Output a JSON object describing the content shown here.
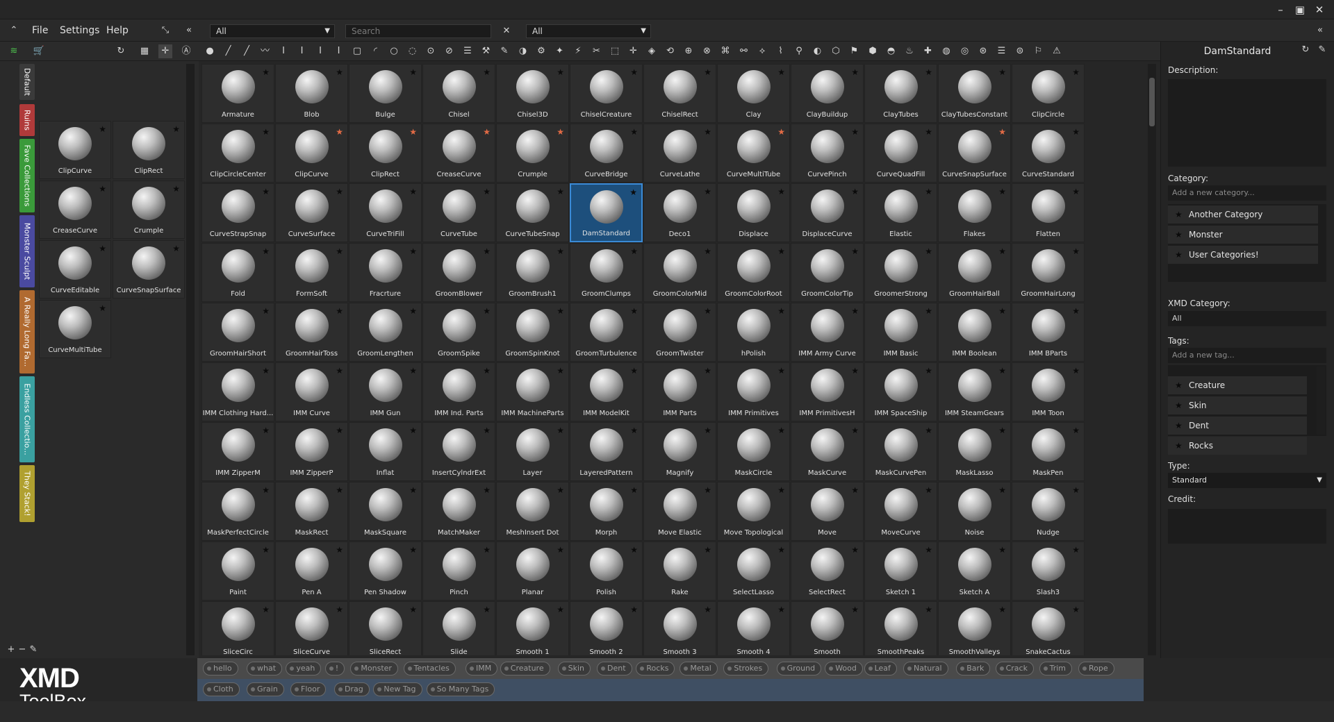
{
  "window": {
    "minimize": "–",
    "maximize": "▣",
    "close": "✕"
  },
  "menu": {
    "items": [
      "File",
      "Settings",
      "Help"
    ]
  },
  "filters": {
    "left_select": "All",
    "search_placeholder": "Search",
    "search_clear": "✕",
    "right_select": "All"
  },
  "left_tabs": [
    {
      "label": "Default",
      "color": "#3a3a3a"
    },
    {
      "label": "Ruins",
      "color": "#b03a3a"
    },
    {
      "label": "Fave Collections",
      "color": "#3a9a3a"
    },
    {
      "label": "Monster Sculpt",
      "color": "#4a4aa0"
    },
    {
      "label": "A Really Long Fa...",
      "color": "#b06a30"
    },
    {
      "label": "Endless Collectio...",
      "color": "#3aa0a0"
    },
    {
      "label": "They Stack!",
      "color": "#b0a030"
    }
  ],
  "left_brushes": [
    "ClipCurve",
    "ClipRect",
    "CreaseCurve",
    "Crumple",
    "CurveEditable",
    "CurveSnapSurface",
    "CurveMultiTube"
  ],
  "brushes": [
    "Armature",
    "Blob",
    "Bulge",
    "Chisel",
    "Chisel3D",
    "ChiselCreature",
    "ChiselRect",
    "Clay",
    "ClayBuildup",
    "ClayTubes",
    "ClayTubesConstant",
    "ClipCircle",
    "ClipCircleCenter",
    "ClipCurve",
    "ClipRect",
    "CreaseCurve",
    "Crumple",
    "CurveBridge",
    "CurveLathe",
    "CurveMultiTube",
    "CurvePinch",
    "CurveQuadFill",
    "CurveSnapSurface",
    "CurveStandard",
    "CurveStrapSnap",
    "CurveSurface",
    "CurveTriFill",
    "CurveTube",
    "CurveTubeSnap",
    "DamStandard",
    "Deco1",
    "Displace",
    "DisplaceCurve",
    "Elastic",
    "Flakes",
    "Flatten",
    "Fold",
    "FormSoft",
    "Fracrture",
    "GroomBlower",
    "GroomBrush1",
    "GroomClumps",
    "GroomColorMid",
    "GroomColorRoot",
    "GroomColorTip",
    "GroomerStrong",
    "GroomHairBall",
    "GroomHairLong",
    "GroomHairShort",
    "GroomHairToss",
    "GroomLengthen",
    "GroomSpike",
    "GroomSpinKnot",
    "GroomTurbulence",
    "GroomTwister",
    "hPolish",
    "IMM Army Curve",
    "IMM Basic",
    "IMM Boolean",
    "IMM BParts",
    "IMM Clothing Hard...",
    "IMM Curve",
    "IMM Gun",
    "IMM Ind. Parts",
    "IMM MachineParts",
    "IMM ModelKit",
    "IMM Parts",
    "IMM Primitives",
    "IMM PrimitivesH",
    "IMM SpaceShip",
    "IMM SteamGears",
    "IMM Toon",
    "IMM ZipperM",
    "IMM ZipperP",
    "Inflat",
    "InsertCylndrExt",
    "Layer",
    "LayeredPattern",
    "Magnify",
    "MaskCircle",
    "MaskCurve",
    "MaskCurvePen",
    "MaskLasso",
    "MaskPen",
    "MaskPerfectCircle",
    "MaskRect",
    "MaskSquare",
    "MatchMaker",
    "MeshInsert Dot",
    "Morph",
    "Move Elastic",
    "Move Topological",
    "Move",
    "MoveCurve",
    "Noise",
    "Nudge",
    "Paint",
    "Pen A",
    "Pen Shadow",
    "Pinch",
    "Planar",
    "Polish",
    "Rake",
    "SelectLasso",
    "SelectRect",
    "Sketch 1",
    "Sketch A",
    "Slash3",
    "SliceCirc",
    "SliceCurve",
    "SliceRect",
    "Slide",
    "Smooth 1",
    "Smooth 2",
    "Smooth 3",
    "Smooth 4",
    "Smooth",
    "SmoothPeaks",
    "SmoothValleys",
    "SnakeCactus"
  ],
  "favorites": [
    "ClipCurve",
    "ClipRect",
    "CreaseCurve",
    "Crumple",
    "CurveMultiTube",
    "CurveSnapSurface"
  ],
  "selected": "DamStandard",
  "details": {
    "title": "DamStandard",
    "description_label": "Description:",
    "category_label": "Category:",
    "category_placeholder": "Add a new category...",
    "categories": [
      "Another Category",
      "Monster",
      "User Categories!"
    ],
    "xmd_category_label": "XMD Category:",
    "xmd_category_value": "All",
    "tags_label": "Tags:",
    "tags_placeholder": "Add a new tag...",
    "tags": [
      "Creature",
      "Skin",
      "Dent",
      "Rocks"
    ],
    "type_label": "Type:",
    "type_value": "Standard",
    "credit_label": "Credit:"
  },
  "tag_row1": [
    "hello",
    "what",
    "yeah",
    "!",
    "Monster",
    "Tentacles",
    "IMM",
    "Creature",
    "Skin",
    "Dent",
    "Rocks",
    "Metal",
    "Strokes",
    "Ground",
    "Wood",
    "Leaf",
    "Natural",
    "Bark",
    "Crack",
    "Trim",
    "Rope"
  ],
  "tag_row2": [
    "Cloth",
    "Grain",
    "Floor",
    "Drag",
    "New Tag",
    "So Many Tags"
  ],
  "logo": {
    "line1": "XMD",
    "line2": "ToolBox"
  }
}
